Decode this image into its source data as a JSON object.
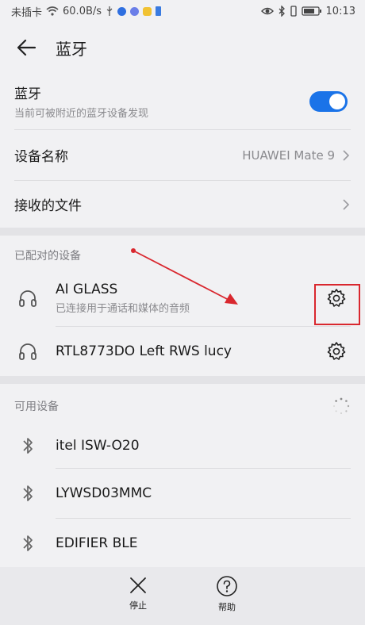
{
  "status_bar": {
    "carrier": "未插卡",
    "speed": "60.0B/s",
    "time": "10:13"
  },
  "app_bar": {
    "title": "蓝牙",
    "back_icon": "arrow-left-icon"
  },
  "bluetooth": {
    "title": "蓝牙",
    "subtitle": "当前可被附近的蓝牙设备发现",
    "enabled": true,
    "toggle_color": "#1a73e8"
  },
  "device_name": {
    "label": "设备名称",
    "value": "HUAWEI Mate 9"
  },
  "received_files": {
    "label": "接收的文件"
  },
  "paired": {
    "header": "已配对的设备",
    "devices": [
      {
        "name": "AI GLASS",
        "status": "已连接用于通话和媒体的音频"
      },
      {
        "name": "RTL8773DO Left RWS lucy",
        "status": ""
      }
    ]
  },
  "available": {
    "header": "可用设备",
    "devices": [
      {
        "name": "itel ISW-O20"
      },
      {
        "name": "LYWSD03MMC"
      },
      {
        "name": "EDIFIER BLE"
      }
    ]
  },
  "bottom_bar": {
    "stop_label": "停止",
    "help_label": "帮助"
  },
  "annotation_color": "#d9272e"
}
